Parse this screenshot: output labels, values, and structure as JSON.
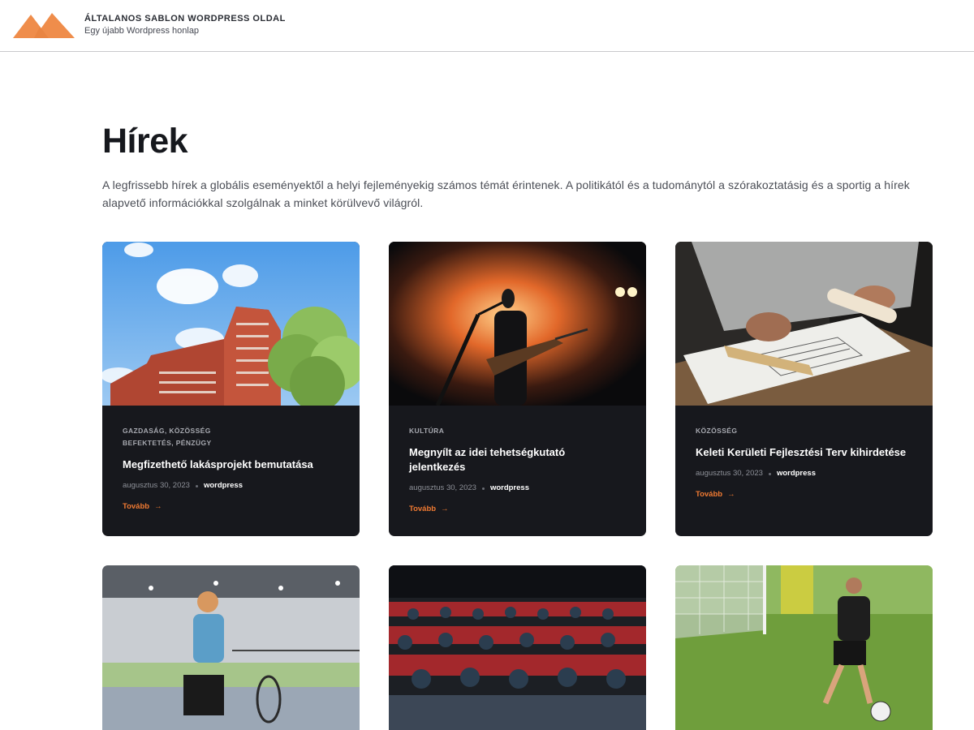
{
  "site": {
    "title": "ÁLTALANOS SABLON WORDPRESS OLDAL",
    "tagline": "Egy újabb Wordpress honlap",
    "accent": "#f07a32",
    "logo_color": "#ef8d4b"
  },
  "page": {
    "title": "Hírek",
    "intro": "A legfrissebb hírek a globális eseményektől a helyi fejleményekig számos témát érintenek. A politikától és a tudománytól a szórakoztatásig és a sportig a hírek alapvető információkkal szolgálnak a minket körülvevő világról."
  },
  "posts": [
    {
      "categories": "GAZDASÁG, KÖZÖSSÉG BEFEKTETÉS, PÉNZÜGY",
      "title": "Megfizethető lakásprojekt bemutatása",
      "date": "augusztus 30, 2023",
      "author": "wordpress",
      "more": "Tovább"
    },
    {
      "categories": "KULTÚRA",
      "title": "Megnyílt az idei tehetségkutató jelentkezés",
      "date": "augusztus 30, 2023",
      "author": "wordpress",
      "more": "Tovább"
    },
    {
      "categories": "KÖZÖSSÉG",
      "title": "Keleti Kerületi Fejlesztési Terv kihirdetése",
      "date": "augusztus 30, 2023",
      "author": "wordpress",
      "more": "Tovább"
    }
  ]
}
